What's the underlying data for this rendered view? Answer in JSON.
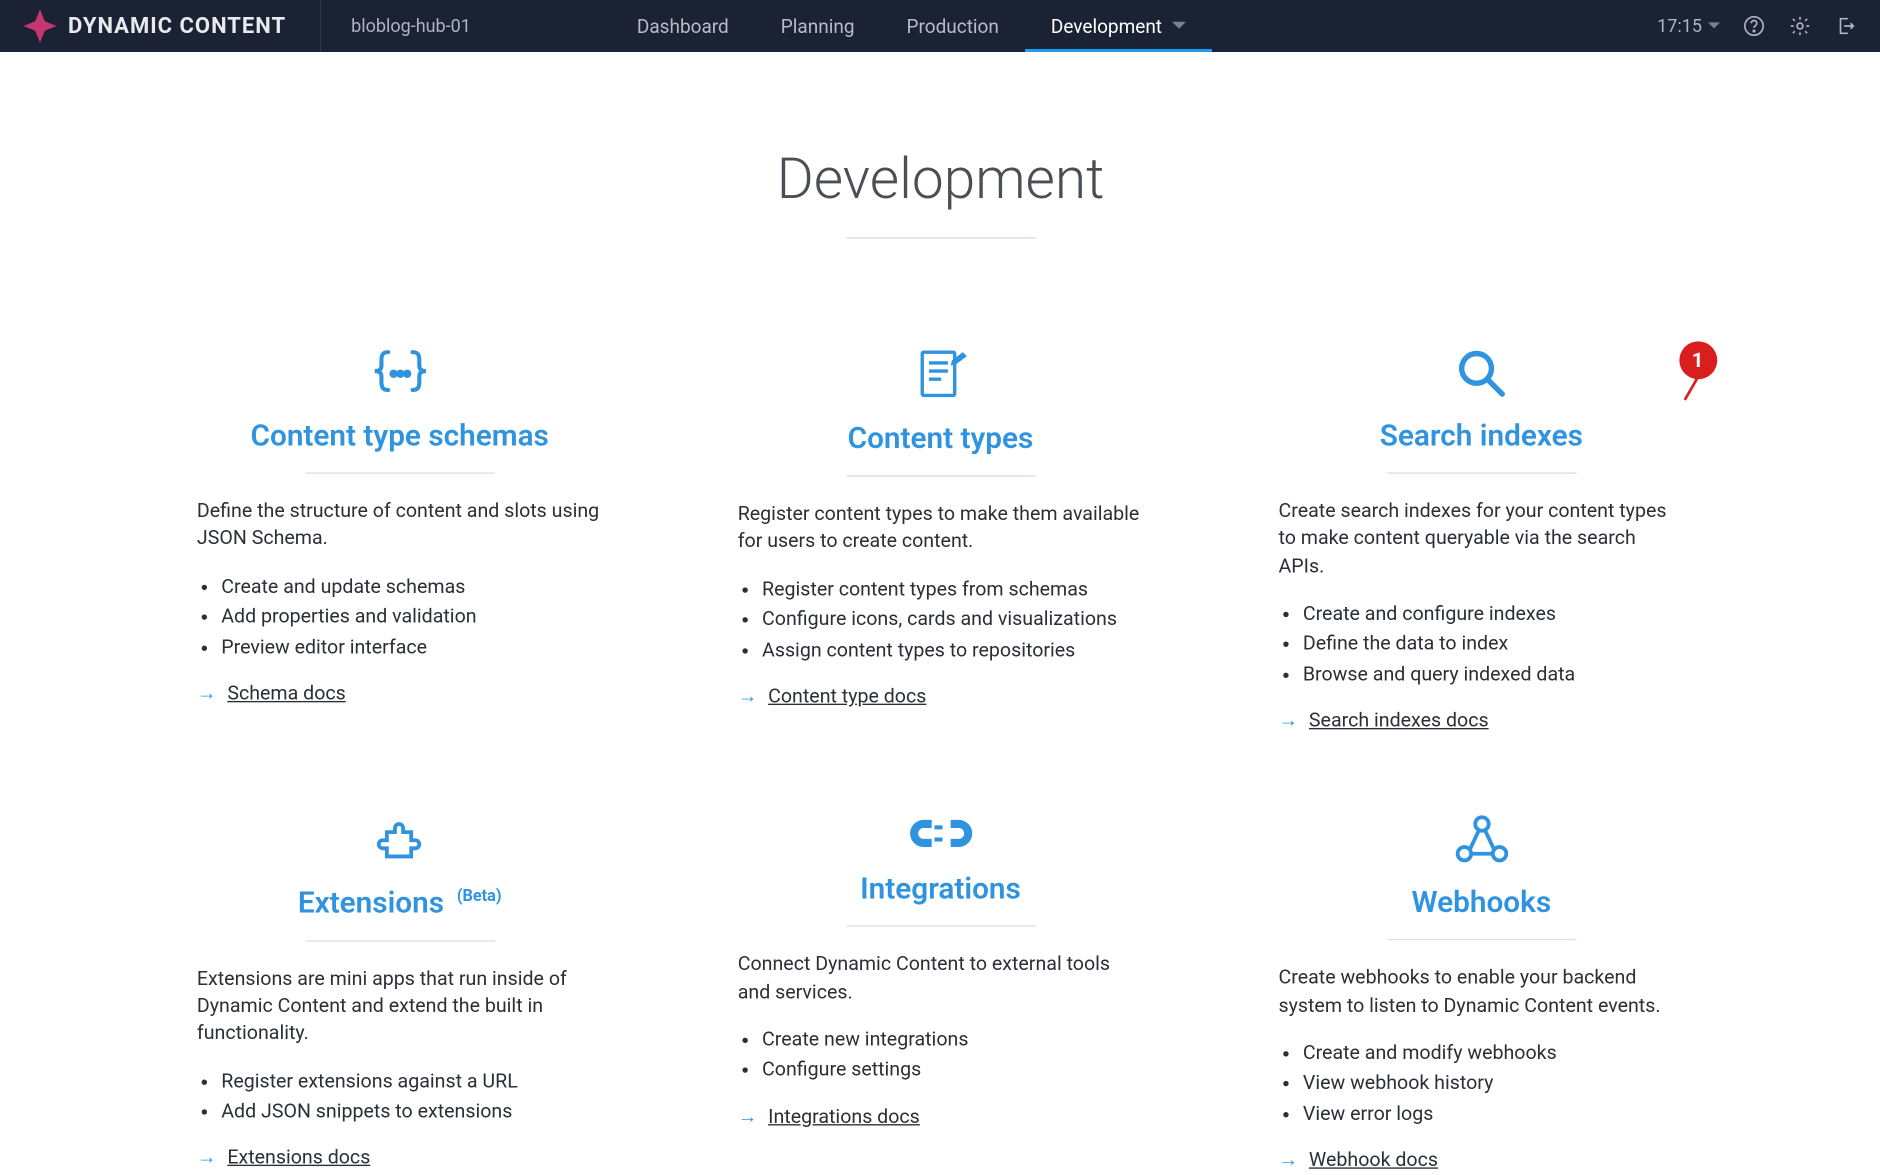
{
  "header": {
    "brand": "DYNAMIC CONTENT",
    "hub": "bloblog-hub-01",
    "nav": [
      "Dashboard",
      "Planning",
      "Production",
      "Development"
    ],
    "active_nav_index": 3,
    "time": "17:15"
  },
  "page": {
    "title": "Development"
  },
  "annotations": {
    "pin_1": "1"
  },
  "cards": [
    {
      "icon": "braces-icon",
      "title": "Content type schemas",
      "badge": "",
      "desc": "Define the structure of content and slots using JSON Schema.",
      "bullets": [
        "Create and update schemas",
        "Add properties and validation",
        "Preview editor interface"
      ],
      "link": "Schema docs"
    },
    {
      "icon": "document-edit-icon",
      "title": "Content types",
      "badge": "",
      "desc": "Register content types to make them available for users to create content.",
      "bullets": [
        "Register content types from schemas",
        "Configure icons, cards and visualizations",
        "Assign content types to repositories"
      ],
      "link": "Content type docs"
    },
    {
      "icon": "search-icon",
      "title": "Search indexes",
      "badge": "",
      "desc": "Create search indexes for your content types to make content queryable via the search APIs.",
      "bullets": [
        "Create and configure indexes",
        "Define the data to index",
        "Browse and query indexed data"
      ],
      "link": "Search indexes docs",
      "pin": "pin_1"
    },
    {
      "icon": "puzzle-icon",
      "title": "Extensions",
      "badge": "(Beta)",
      "desc": "Extensions are mini apps that run inside of Dynamic Content and extend the built in functionality.",
      "bullets": [
        "Register extensions against a URL",
        "Add JSON snippets to extensions"
      ],
      "link": "Extensions docs"
    },
    {
      "icon": "plug-icon",
      "title": "Integrations",
      "badge": "",
      "desc": "Connect Dynamic Content to external tools and services.",
      "bullets": [
        "Create new integrations",
        "Configure settings"
      ],
      "link": "Integrations docs"
    },
    {
      "icon": "webhook-icon",
      "title": "Webhooks",
      "badge": "",
      "desc": "Create webhooks to enable your backend system to listen to Dynamic Content events.",
      "bullets": [
        "Create and modify webhooks",
        "View webhook history",
        "View error logs"
      ],
      "link": "Webhook docs"
    }
  ]
}
